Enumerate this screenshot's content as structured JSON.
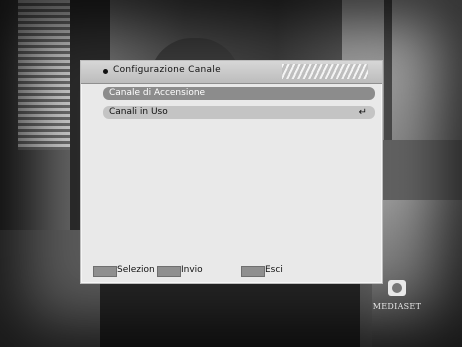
{
  "osd": {
    "title": "Configurazione Canale",
    "menu_items": [
      {
        "label": "Canale di Accensione",
        "selected": true
      },
      {
        "label": "Canali in Uso",
        "selected": false,
        "submenu_icon": "enter-arrow-icon"
      }
    ],
    "footer": {
      "select_label": "Selezion",
      "enter_label": "Invio",
      "exit_label": "Esci"
    }
  },
  "brand": {
    "name": "MEDIASET"
  },
  "colors": {
    "panel": "#e9e9e9",
    "highlight": "#8c8c8c",
    "row": "#c4c4c4"
  }
}
